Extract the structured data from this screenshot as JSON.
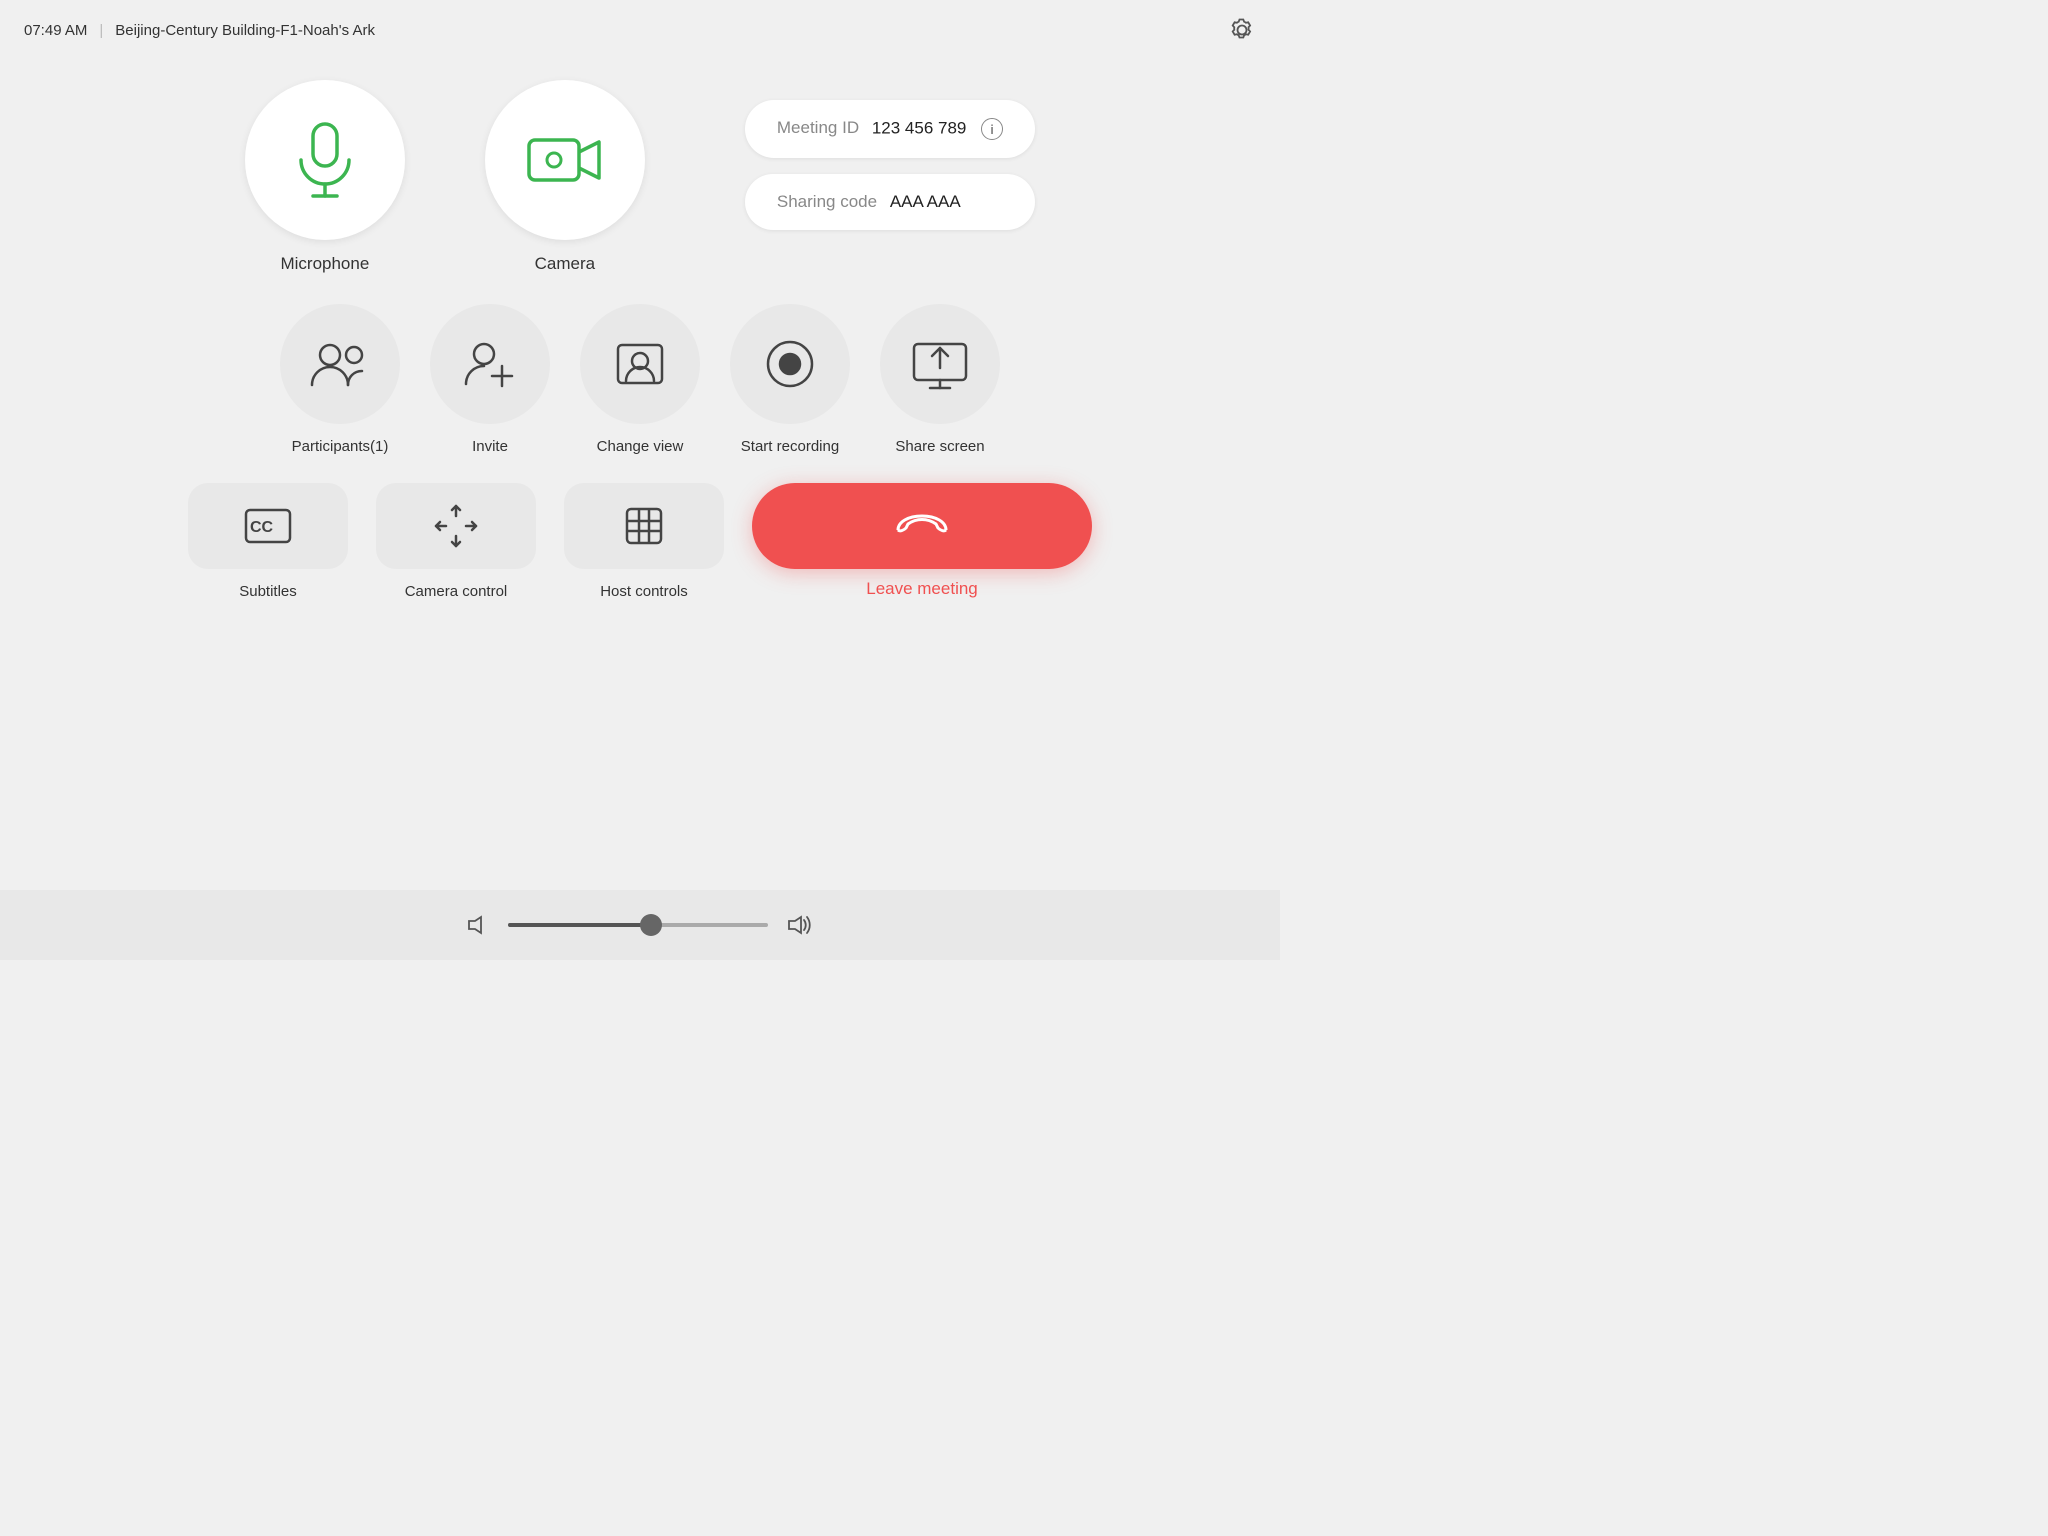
{
  "header": {
    "time": "07:49 AM",
    "location": "Beijing-Century Building-F1-Noah's Ark",
    "settings_icon": "gear-icon"
  },
  "meeting_info": {
    "id_label": "Meeting ID",
    "id_value": "123 456 789",
    "sharing_label": "Sharing code",
    "sharing_value": "AAA AAA"
  },
  "device_controls": [
    {
      "id": "microphone",
      "label": "Microphone"
    },
    {
      "id": "camera",
      "label": "Camera"
    }
  ],
  "action_controls": [
    {
      "id": "participants",
      "label": "Participants(1)"
    },
    {
      "id": "invite",
      "label": "Invite"
    },
    {
      "id": "change-view",
      "label": "Change view"
    },
    {
      "id": "start-recording",
      "label": "Start recording"
    },
    {
      "id": "share-screen",
      "label": "Share screen"
    }
  ],
  "bottom_controls": [
    {
      "id": "subtitles",
      "label": "Subtitles"
    },
    {
      "id": "camera-control",
      "label": "Camera control"
    },
    {
      "id": "host-controls",
      "label": "Host controls"
    }
  ],
  "leave": {
    "button_label": "Leave meeting"
  },
  "volume": {
    "level": 55
  }
}
